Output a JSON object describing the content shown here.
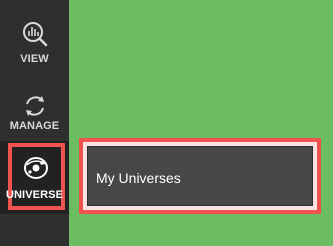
{
  "sidebar": {
    "items": [
      {
        "label": "VIEW",
        "icon": "view-icon"
      },
      {
        "label": "MANAGE",
        "icon": "manage-icon"
      },
      {
        "label": "UNIVERSE",
        "icon": "universe-icon",
        "selected": true
      }
    ]
  },
  "flyout": {
    "items": [
      {
        "label": "My Universes"
      }
    ]
  },
  "colors": {
    "background": "#6cbd62",
    "sidebar": "#2f2f2f",
    "highlight": "#ef5350",
    "flyout": "#474747"
  }
}
